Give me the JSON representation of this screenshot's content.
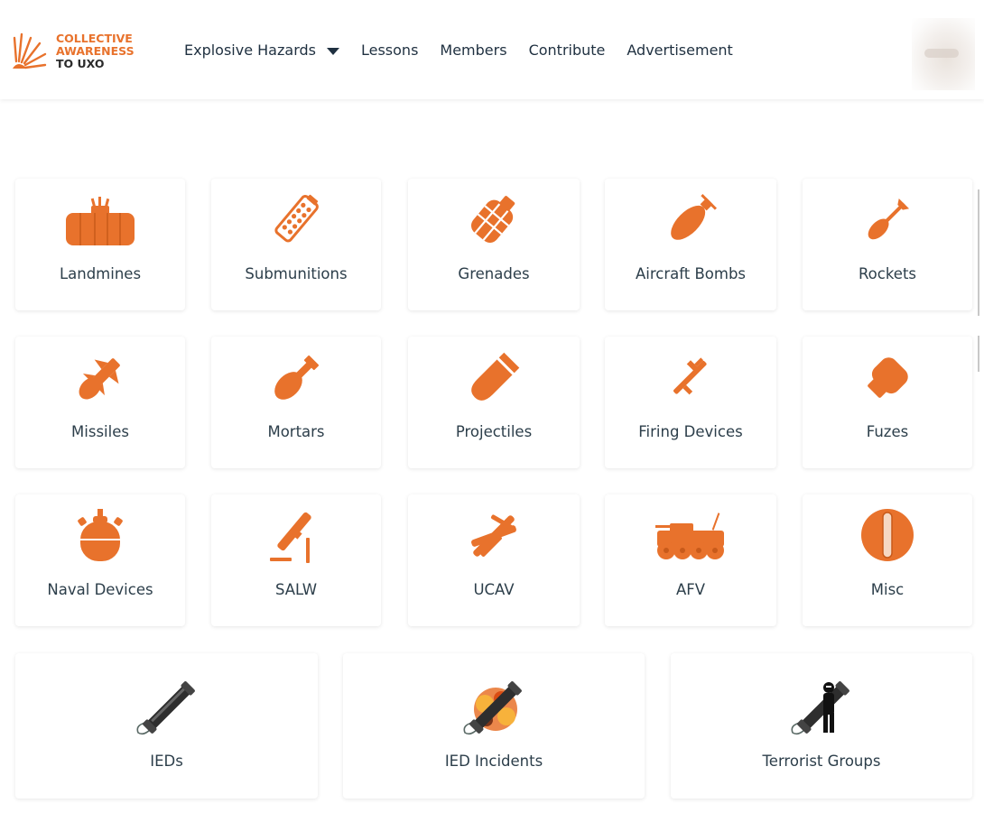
{
  "brand": {
    "logo_lines": [
      "COLLECTIVE",
      "AWARENESS",
      "TO UXO"
    ],
    "logo_icon": "explosion-burst-icon",
    "accent_color": "#e8722c"
  },
  "nav": {
    "items": [
      {
        "label": "Explosive Hazards",
        "has_dropdown": true
      },
      {
        "label": "Lessons"
      },
      {
        "label": "Members"
      },
      {
        "label": "Contribute"
      },
      {
        "label": "Advertisement"
      }
    ]
  },
  "categories": [
    {
      "label": "Landmines",
      "icon": "landmine-icon"
    },
    {
      "label": "Submunitions",
      "icon": "submunition-icon"
    },
    {
      "label": "Grenades",
      "icon": "grenade-icon"
    },
    {
      "label": "Aircraft Bombs",
      "icon": "aircraft-bomb-icon"
    },
    {
      "label": "Rockets",
      "icon": "rocket-icon"
    },
    {
      "label": "Missiles",
      "icon": "missile-icon"
    },
    {
      "label": "Mortars",
      "icon": "mortar-icon"
    },
    {
      "label": "Projectiles",
      "icon": "projectile-icon"
    },
    {
      "label": "Firing Devices",
      "icon": "firing-device-icon"
    },
    {
      "label": "Fuzes",
      "icon": "fuze-icon"
    },
    {
      "label": "Naval Devices",
      "icon": "naval-mine-icon"
    },
    {
      "label": "SALW",
      "icon": "salw-icon"
    },
    {
      "label": "UCAV",
      "icon": "ucav-icon"
    },
    {
      "label": "AFV",
      "icon": "afv-icon"
    },
    {
      "label": "Misc",
      "icon": "misc-icon"
    }
  ],
  "ied_categories": [
    {
      "label": "IEDs",
      "icon": "ied-pipe-bomb-icon"
    },
    {
      "label": "IED Incidents",
      "icon": "ied-explosion-icon"
    },
    {
      "label": "Terrorist Groups",
      "icon": "terrorist-group-icon"
    }
  ]
}
